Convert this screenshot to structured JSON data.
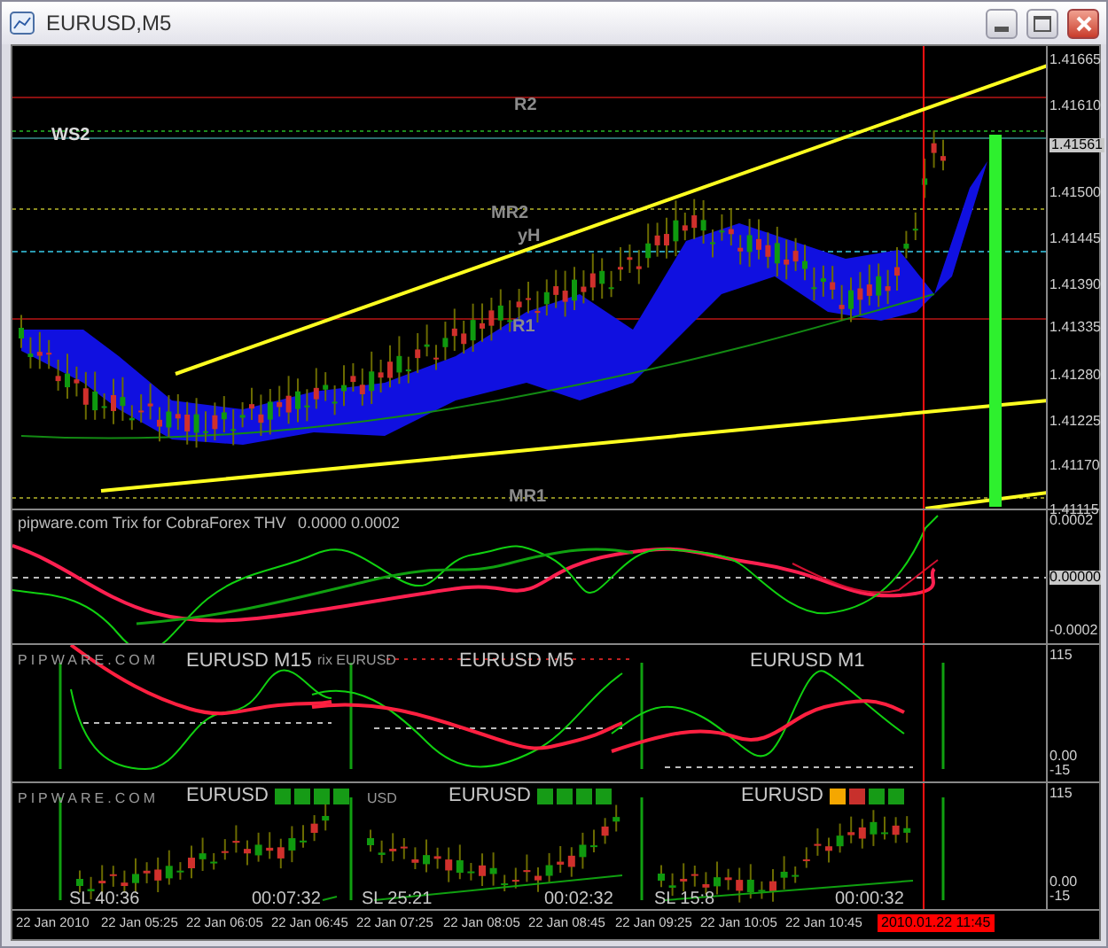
{
  "window": {
    "title": "EURUSD,M5"
  },
  "main_chart": {
    "levels": [
      {
        "label": "R2"
      },
      {
        "label": "WS2"
      },
      {
        "label": "MR2"
      },
      {
        "label": "yH"
      },
      {
        "label": "R1"
      },
      {
        "label": "MR1"
      }
    ],
    "price_axis": [
      "1.41665",
      "1.41610",
      "1.41561",
      "1.41500",
      "1.41445",
      "1.41390",
      "1.41335",
      "1.41280",
      "1.41225",
      "1.41170",
      "1.41115"
    ]
  },
  "trix_pane": {
    "title": "pipware.com Trix for CobraForex THV",
    "values": "0.0000 0.0002",
    "axis": [
      "0.0002",
      "0.00000",
      "-0.0002"
    ]
  },
  "trix_mtf_pane": {
    "watermark": "PIPWARE.COM",
    "overlap_text": "rix EURUSD",
    "titles": [
      "EURUSD M15",
      "EURUSD M5",
      "EURUSD M1"
    ],
    "axis": [
      "115",
      "0.00",
      "-15"
    ]
  },
  "candle_pane": {
    "watermark": "PIPWARE.COM",
    "tail": "USD",
    "panels": [
      {
        "title": "EURUSD",
        "squares": [
          {
            "color": "#169b16"
          },
          {
            "color": "#169b16"
          },
          {
            "color": "#169b16"
          },
          {
            "color": "#169b16"
          }
        ],
        "sl": "SL 40:36",
        "timer": "00:07:32"
      },
      {
        "title": "EURUSD",
        "squares": [
          {
            "color": "#169b16"
          },
          {
            "color": "#169b16"
          },
          {
            "color": "#169b16"
          },
          {
            "color": "#169b16"
          }
        ],
        "sl": "SL 25:21",
        "timer": "00:02:32"
      },
      {
        "title": "EURUSD",
        "squares": [
          {
            "color": "#f5a700"
          },
          {
            "color": "#c8302c"
          },
          {
            "color": "#169b16"
          },
          {
            "color": "#169b16"
          }
        ],
        "sl": "SL 15:8",
        "timer": "00:00:32"
      }
    ],
    "axis": [
      "115",
      "0.00",
      "-15"
    ]
  },
  "time_axis": {
    "labels": [
      "22 Jan 2010",
      "22 Jan 05:25",
      "22 Jan 06:05",
      "22 Jan 06:45",
      "22 Jan 07:25",
      "22 Jan 08:05",
      "22 Jan 08:45",
      "22 Jan 09:25",
      "22 Jan 10:05",
      "22 Jan 10:45"
    ],
    "current": "2010.01.22 11:45"
  }
}
